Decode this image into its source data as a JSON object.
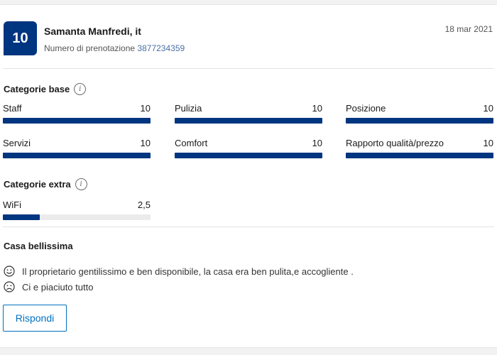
{
  "header": {
    "score": "10",
    "reviewer_name": "Samanta Manfredi, it",
    "booking_label": "Numero di prenotazione",
    "booking_number": "3877234359",
    "date": "18 mar 2021"
  },
  "base_categories": {
    "title": "Categorie base",
    "items": [
      {
        "label": "Staff",
        "value": "10",
        "fraction": 1.0
      },
      {
        "label": "Pulizia",
        "value": "10",
        "fraction": 1.0
      },
      {
        "label": "Posizione",
        "value": "10",
        "fraction": 1.0
      },
      {
        "label": "Servizi",
        "value": "10",
        "fraction": 1.0
      },
      {
        "label": "Comfort",
        "value": "10",
        "fraction": 1.0
      },
      {
        "label": "Rapporto qualità/prezzo",
        "value": "10",
        "fraction": 1.0
      }
    ]
  },
  "extra_categories": {
    "title": "Categorie extra",
    "items": [
      {
        "label": "WiFi",
        "value": "2,5",
        "fraction": 0.25
      }
    ]
  },
  "review": {
    "title": "Casa bellissima",
    "positive": "Il proprietario gentilissimo e ben disponibile, la casa era ben pulita,e accogliente .",
    "negative": "Ci e piaciuto tutto"
  },
  "actions": {
    "reply_label": "Rispondi"
  },
  "colors": {
    "brand": "#003580",
    "link": "#0071c2"
  },
  "icons": {
    "info": "info-icon",
    "positive": "smile-icon",
    "negative": "frown-icon"
  }
}
